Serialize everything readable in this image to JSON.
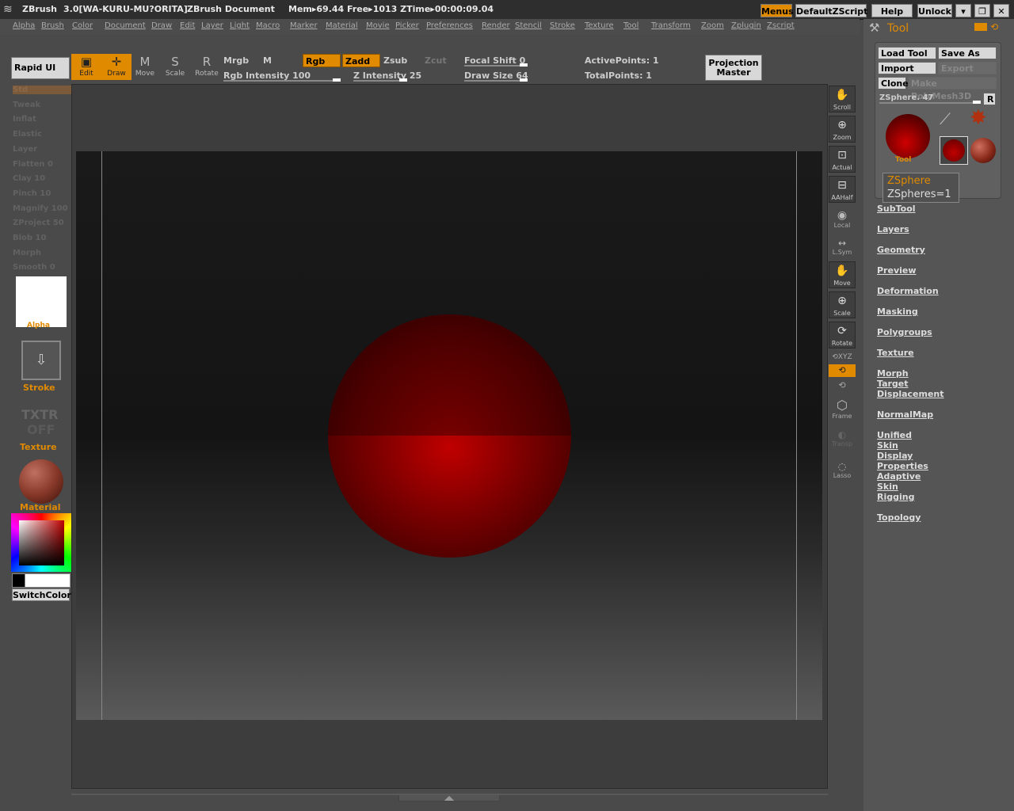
{
  "titlebar": {
    "app": "ZBrush",
    "version": "3.0[WA-KURU-MU?ORITA]",
    "doc": "ZBrush Document",
    "mem": "Mem▸69.44 Free▸1013 ZTime▸00:00:09.04",
    "menus": "Menus",
    "script": "DefaultZScript",
    "help": "Help",
    "unlock": "Unlock"
  },
  "menubar": [
    "Alpha",
    "Brush",
    "Color",
    "Document",
    "Draw",
    "Edit",
    "Layer",
    "Light",
    "Macro",
    "Marker",
    "Material",
    "Movie",
    "Picker",
    "Preferences",
    "Render",
    "Stencil",
    "Stroke",
    "Texture",
    "Tool",
    "Transform",
    "Zoom",
    "Zplugin",
    "Zscript"
  ],
  "toolbar": {
    "rapid_ui": "Rapid UI",
    "edit": "Edit",
    "draw": "Draw",
    "move": "Move",
    "scale": "Scale",
    "rotate": "Rotate",
    "mrgb": "Mrgb",
    "m": "M",
    "rgb": "Rgb",
    "zadd": "Zadd",
    "zsub": "Zsub",
    "zcut": "Zcut",
    "rgb_intensity": "Rgb  Intensity 100",
    "z_intensity": "Z  Intensity 25",
    "focal_shift": "Focal  Shift 0",
    "draw_size": "Draw  Size 64",
    "active_points": "ActivePoints: 1",
    "total_points": "TotalPoints: 1",
    "projection_master_1": "Projection",
    "projection_master_2": "Master"
  },
  "leftpanel": {
    "brushes": [
      "Std",
      "Tweak",
      "Inflat",
      "Elastic",
      "Layer",
      "Flatten 0",
      "Clay 10",
      "Pinch 10",
      "Magnify 100",
      "ZProject 50",
      "Blob 10",
      "Morph",
      "Smooth 0"
    ],
    "alpha": "Alpha",
    "stroke": "Stroke",
    "texture_1": "TXTR",
    "texture_2": "OFF",
    "texture": "Texture",
    "material": "Material",
    "switchcolor": "SwitchColor"
  },
  "rightstrip": {
    "scroll": "Scroll",
    "zoom": "Zoom",
    "actual": "Actual",
    "aahalf": "AAHalf",
    "local": "Local",
    "lsym": "L.Sym",
    "move": "Move",
    "scale": "Scale",
    "rotate": "Rotate",
    "xyz": "XYZ",
    "frame": "Frame",
    "transp": "Transp",
    "lasso": "Lasso"
  },
  "toolpanel": {
    "title": "Tool",
    "load_tool": "Load Tool",
    "save_as": "Save As",
    "import": "Import",
    "export": "Export",
    "clone": "Clone",
    "make_polymesh": "Make PolyMesh3D",
    "zsphere_slider": "ZSphere. 47",
    "r": "R",
    "tool_label": "Tool",
    "tooltip_1": "ZSphere",
    "tooltip_2": "ZSpheres=1",
    "items": [
      "SubTool",
      "Layers",
      "Geometry",
      "Preview",
      "Deformation",
      "Masking",
      "Polygroups",
      "Texture",
      "Morph Target",
      "Displacement",
      "NormalMap",
      "Unified Skin",
      "Display Properties",
      "Adaptive Skin",
      "Rigging",
      "Topology"
    ]
  },
  "colors": {
    "accent": "#e08a00",
    "sphere": "#8a0000"
  }
}
